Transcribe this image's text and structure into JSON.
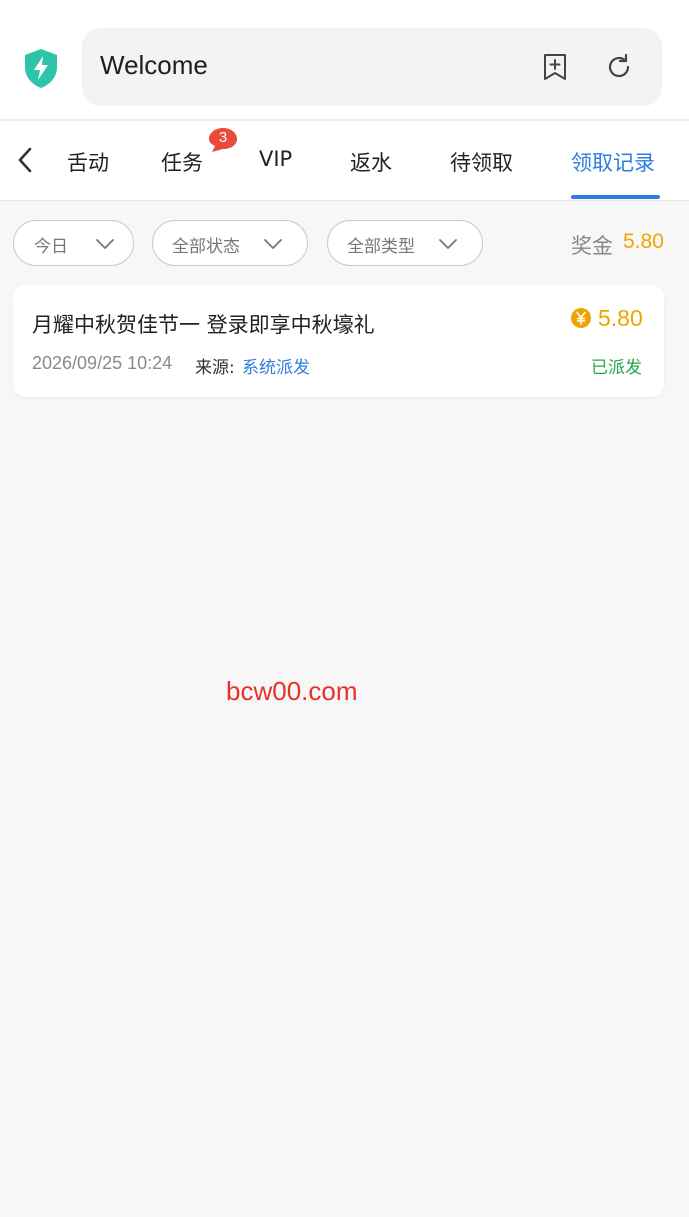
{
  "browser": {
    "address_text": "Welcome",
    "icons": [
      "shield-bolt-icon",
      "bookmark-add-icon",
      "refresh-icon"
    ],
    "shield_color": "#2ec4a8"
  },
  "tabs": {
    "items": [
      {
        "label": "舌动",
        "active": false
      },
      {
        "label": "任务",
        "active": false,
        "badge": "3"
      },
      {
        "label": "VIP",
        "active": false
      },
      {
        "label": "返水",
        "active": false
      },
      {
        "label": "待领取",
        "active": false
      },
      {
        "label": "领取记录",
        "active": true
      }
    ],
    "accent_color": "#2d7ee0",
    "badge_color": "#e84a3c"
  },
  "filters": {
    "date": "今日",
    "status": "全部状态",
    "type": "全部类型"
  },
  "bonus": {
    "label": "奖金",
    "value": "5.80",
    "color": "#f0a400"
  },
  "records": [
    {
      "title": "月耀中秋贺佳节一 登录即享中秋壕礼",
      "amount": "5.80",
      "time": "2026/09/25 10:24",
      "source_label": "来源:",
      "source_value": "系统派发",
      "status": "已派发",
      "status_color": "#28a745"
    }
  ],
  "watermark": "bcw00.com"
}
